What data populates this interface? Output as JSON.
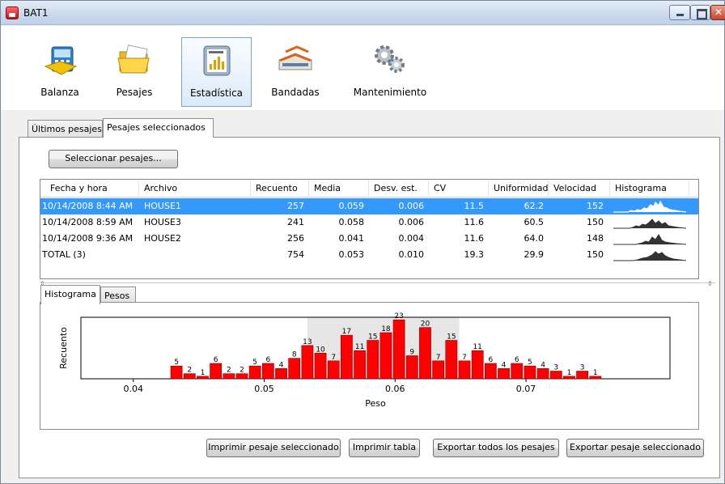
{
  "window": {
    "title": "BAT1"
  },
  "toolbar": {
    "items": [
      {
        "label": "Balanza",
        "icon": "scale-icon"
      },
      {
        "label": "Pesajes",
        "icon": "folder-icon"
      },
      {
        "label": "Estadística",
        "icon": "statistics-icon",
        "selected": true
      },
      {
        "label": "Bandadas",
        "icon": "farm-buildings-icon"
      },
      {
        "label": "Mantenimiento",
        "icon": "gears-icon"
      }
    ]
  },
  "tabs": {
    "recent": "Últimos pesajes",
    "selected": "Pesajes seleccionados"
  },
  "select_button": "Seleccionar pesajes...",
  "grid": {
    "columns": [
      "Fecha y hora",
      "Archivo",
      "Recuento",
      "Media",
      "Desv. est.",
      "CV",
      "Uniformidad",
      "Velocidad",
      "Histograma"
    ],
    "rows": [
      {
        "date": "10/14/2008 8:44 AM",
        "file": "HOUSE1",
        "count": "257",
        "mean": "0.059",
        "std": "0.006",
        "cv": "11.5",
        "uniformity": "62.2",
        "speed": "152",
        "selected": true
      },
      {
        "date": "10/14/2008 8:59 AM",
        "file": "HOUSE3",
        "count": "241",
        "mean": "0.058",
        "std": "0.006",
        "cv": "11.6",
        "uniformity": "60.5",
        "speed": "150",
        "selected": false
      },
      {
        "date": "10/14/2008 9:36 AM",
        "file": "HOUSE2",
        "count": "256",
        "mean": "0.041",
        "std": "0.004",
        "cv": "11.6",
        "uniformity": "64.0",
        "speed": "148",
        "selected": false
      },
      {
        "date": "TOTAL (3)",
        "file": "",
        "count": "754",
        "mean": "0.053",
        "std": "0.010",
        "cv": "19.3",
        "uniformity": "29.9",
        "speed": "150",
        "selected": false
      }
    ]
  },
  "bottom_tabs": {
    "histogram": "Histograma",
    "weights": "Pesos"
  },
  "buttons": {
    "print_selected": "Imprimir pesaje seleccionado",
    "print_table": "Imprimir tabla",
    "export_all": "Exportar todos los pesajes",
    "export_selected": "Exportar pesaje seleccionado"
  },
  "colors": {
    "bar": "#ff0000",
    "bar_border": "#8b0000",
    "uniformity_band": "#e6e6e6",
    "selection": "#3399ff"
  },
  "chart_data": {
    "type": "bar",
    "xlabel": "Peso",
    "ylabel": "Recuento",
    "xlim": [
      0.036,
      0.081
    ],
    "xticks": [
      "0.04",
      "0.05",
      "0.06",
      "0.07"
    ],
    "uniformity_band": [
      0.0533,
      0.0649
    ],
    "bin_width": 0.001,
    "x": [
      0.0433,
      0.0443,
      0.0453,
      0.0463,
      0.0473,
      0.0483,
      0.0493,
      0.0503,
      0.0513,
      0.0523,
      0.0533,
      0.0543,
      0.0553,
      0.0563,
      0.0573,
      0.0583,
      0.0593,
      0.0603,
      0.0613,
      0.0623,
      0.0633,
      0.0643,
      0.0653,
      0.0663,
      0.0673,
      0.0683,
      0.0693,
      0.0703,
      0.0713,
      0.0723,
      0.0733,
      0.0743,
      0.0753
    ],
    "values": [
      5,
      2,
      1,
      6,
      2,
      2,
      5,
      6,
      4,
      8,
      13,
      10,
      7,
      17,
      11,
      15,
      18,
      23,
      9,
      20,
      7,
      15,
      7,
      11,
      6,
      4,
      6,
      5,
      4,
      3,
      1,
      3,
      1
    ],
    "ylim": [
      0,
      24
    ]
  }
}
